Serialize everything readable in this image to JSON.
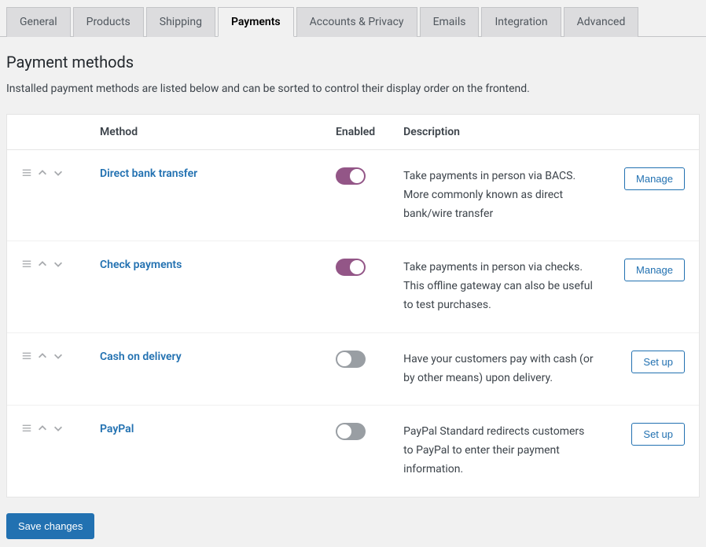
{
  "tabs": [
    {
      "label": "General",
      "active": false
    },
    {
      "label": "Products",
      "active": false
    },
    {
      "label": "Shipping",
      "active": false
    },
    {
      "label": "Payments",
      "active": true
    },
    {
      "label": "Accounts & Privacy",
      "active": false
    },
    {
      "label": "Emails",
      "active": false
    },
    {
      "label": "Integration",
      "active": false
    },
    {
      "label": "Advanced",
      "active": false
    }
  ],
  "page": {
    "title": "Payment methods",
    "subtitle": "Installed payment methods are listed below and can be sorted to control their display order on the frontend."
  },
  "table": {
    "headers": {
      "method": "Method",
      "enabled": "Enabled",
      "description": "Description"
    },
    "rows": [
      {
        "method": "Direct bank transfer",
        "enabled": true,
        "description": "Take payments in person via BACS. More commonly known as direct bank/wire transfer",
        "action": "Manage"
      },
      {
        "method": "Check payments",
        "enabled": true,
        "description": "Take payments in person via checks. This offline gateway can also be useful to test purchases.",
        "action": "Manage"
      },
      {
        "method": "Cash on delivery",
        "enabled": false,
        "description": "Have your customers pay with cash (or by other means) upon delivery.",
        "action": "Set up"
      },
      {
        "method": "PayPal",
        "enabled": false,
        "description": "PayPal Standard redirects customers to PayPal to enter their payment information.",
        "action": "Set up"
      }
    ]
  },
  "save_button": "Save changes"
}
